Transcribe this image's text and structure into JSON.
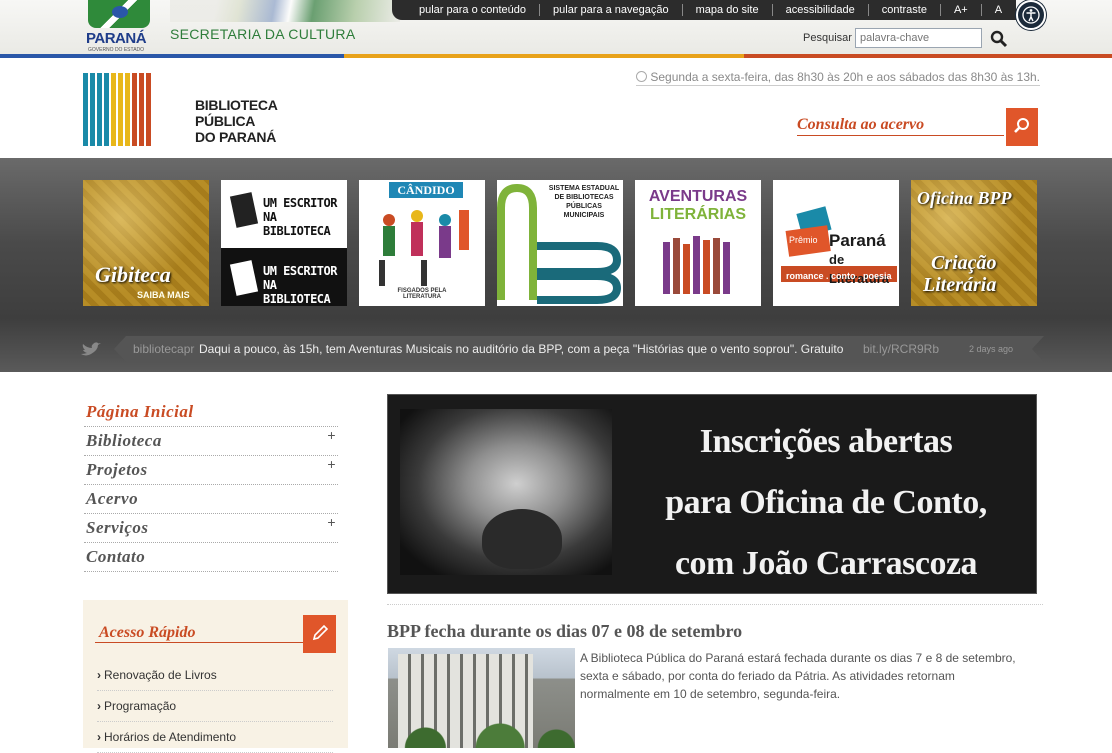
{
  "gov": {
    "logo_word": "PARANÁ",
    "logo_sub": "GOVERNO DO ESTADO",
    "secretaria": "SECRETARIA DA CULTURA",
    "links": [
      "pular para o conteúdo",
      "pular para a navegação",
      "mapa do site",
      "acessibilidade",
      "contraste",
      "A+",
      "A"
    ],
    "search_label": "Pesquisar",
    "search_placeholder": "palavra-chave"
  },
  "library": {
    "name_line1": "BIBLIOTECA",
    "name_line2": "PÚBLICA",
    "name_line3": "DO PARANÁ",
    "hours": "Segunda a sexta-feira, das 8h30 às 20h e aos sábados das 8h30 às 13h.",
    "consulta": "Consulta ao acervo"
  },
  "tiles": {
    "gibiteca": {
      "title": "Gibiteca",
      "sub": "SAIBA MAIS"
    },
    "escritor": {
      "line1": "UM ESCRITOR NA",
      "line2": "BIBLIOTECA"
    },
    "candido": {
      "title": "CÂNDIDO",
      "sub": "FISGADOS PELA LITERATURA"
    },
    "sistema": {
      "text": "SISTEMA ESTADUAL DE BIBLIOTECAS PÚBLICAS MUNICIPAIS"
    },
    "aventuras": {
      "line1": "AVENTURAS",
      "line2": "LITERÁRIAS"
    },
    "premio": {
      "small": "Prêmio",
      "big1": "Paraná",
      "big2": "de Literatura",
      "sub": "romance . conto . poesia"
    },
    "oficina": {
      "title": "Oficina BPP",
      "line1": "Criação",
      "line2": "Literária"
    }
  },
  "tweet": {
    "user": "bibliotecapr",
    "text": "Daqui a pouco, às 15h, tem Aventuras Musicais no auditório da BPP, com a peça \"Histórias que o vento soprou\". Gratuito",
    "link": "bit.ly/RCR9Rb",
    "time": "2 days ago"
  },
  "nav": [
    {
      "label": "Página Inicial",
      "plus": ""
    },
    {
      "label": "Biblioteca",
      "plus": "+"
    },
    {
      "label": "Projetos",
      "plus": "+"
    },
    {
      "label": "Acervo",
      "plus": ""
    },
    {
      "label": "Serviços",
      "plus": "+"
    },
    {
      "label": "Contato",
      "plus": ""
    }
  ],
  "quick": {
    "title": "Acesso Rápido",
    "items": [
      "Renovação de Livros",
      "Programação",
      "Horários de Atendimento"
    ]
  },
  "feature": {
    "line1": "Inscrições abertas",
    "line2": "para Oficina de Conto,",
    "line3": "com João Carrascoza"
  },
  "news": {
    "title": "BPP fecha durante os dias 07 e 08 de setembro",
    "body": "A Biblioteca Pública do Paraná estará fechada durante os dias 7 e 8 de setembro, sexta e sábado, por conta do feriado da Pátria. As atividades retornam normalmente em 10 de setembro, segunda-feira."
  },
  "colors": {
    "accent": "#c94b23",
    "accent_button": "#e0562a",
    "gov_green": "#2e7d3a",
    "stripe": [
      "#2a57a8",
      "#e8a21a",
      "#c94b23"
    ]
  }
}
